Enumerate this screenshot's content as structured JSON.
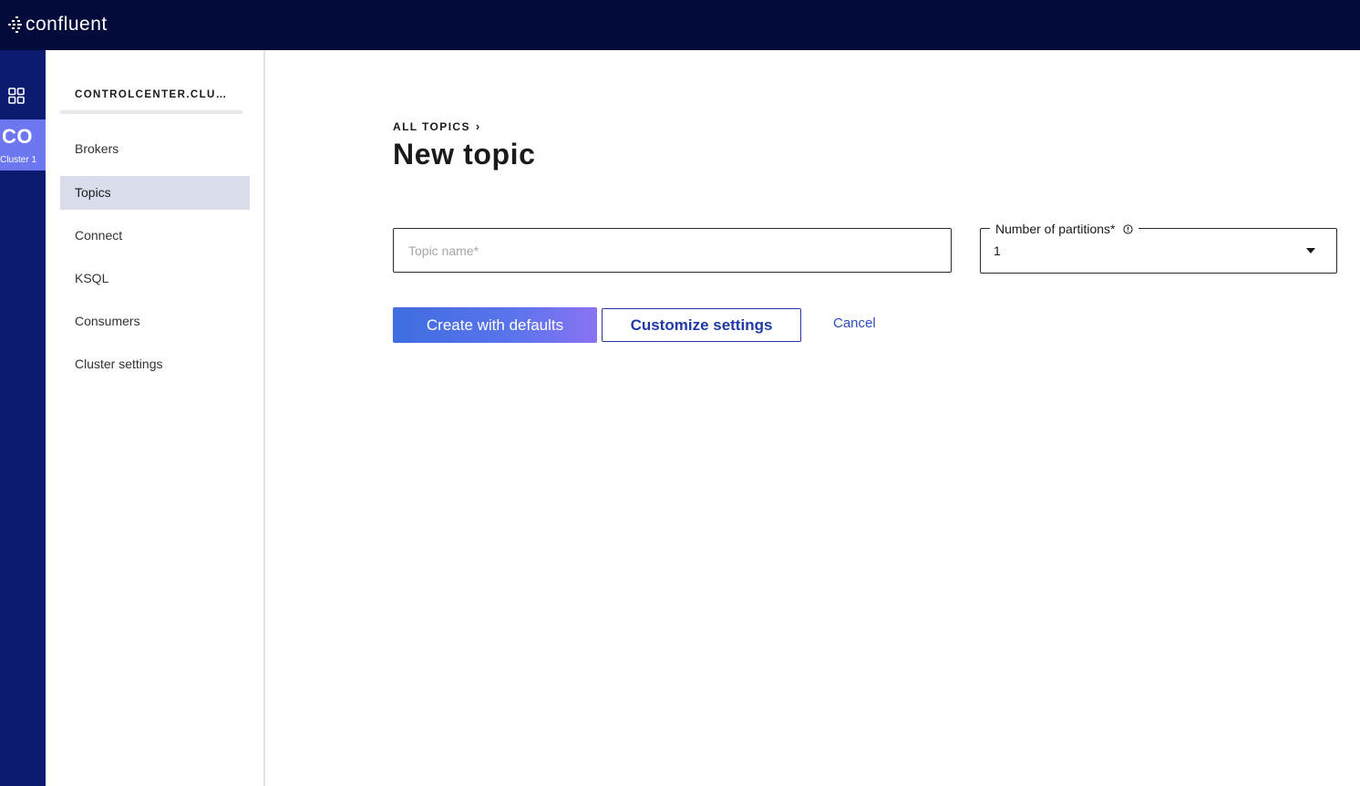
{
  "app": {
    "brand": "confluent",
    "colors": {
      "topbar": "#030b3b",
      "rail": "#0b1a6e",
      "cluster_tile": "#6d77ef",
      "nav_active": "#d9ddeb",
      "primary_gradient_start": "#3f6de0",
      "primary_gradient_end": "#8a73f2",
      "link": "#2c4cc4"
    }
  },
  "rail": {
    "grid_icon": "grid-icon",
    "cluster": {
      "abbr": "CO",
      "name": "Cluster 1"
    }
  },
  "sidebar": {
    "cluster_title": "CONTROLCENTER.CLUSTER",
    "items": [
      {
        "label": "Brokers",
        "active": false
      },
      {
        "label": "Topics",
        "active": true
      },
      {
        "label": "Connect",
        "active": false
      },
      {
        "label": "KSQL",
        "active": false
      },
      {
        "label": "Consumers",
        "active": false
      },
      {
        "label": "Cluster settings",
        "active": false
      }
    ]
  },
  "main": {
    "breadcrumb": {
      "label": "ALL TOPICS",
      "separator": "›"
    },
    "title": "New topic",
    "topic_name": {
      "placeholder": "Topic name*",
      "value": ""
    },
    "partitions": {
      "label": "Number of partitions*",
      "value": "1",
      "info_icon": "info-icon",
      "caret_icon": "chevron-down-icon"
    },
    "actions": {
      "create": "Create with defaults",
      "customize": "Customize settings",
      "cancel": "Cancel"
    }
  }
}
